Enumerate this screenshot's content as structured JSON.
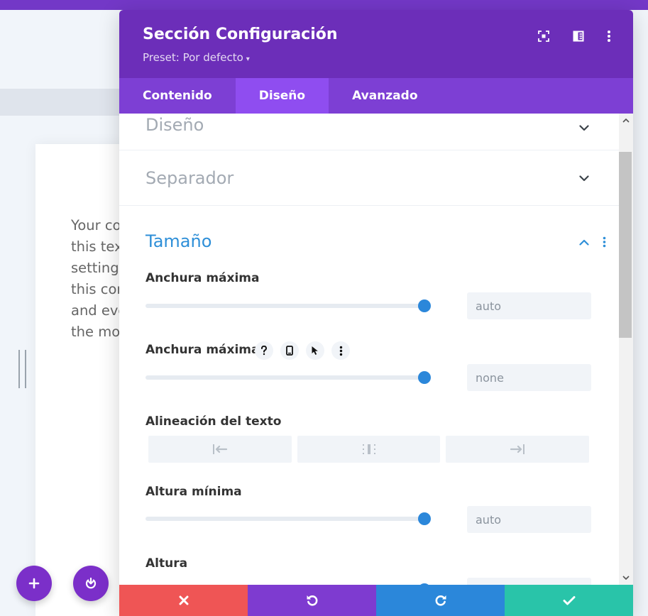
{
  "background": {
    "text_lines": [
      "Your co",
      "this tex",
      "settings",
      "this cor",
      "and eve",
      "the mod"
    ]
  },
  "modal": {
    "title": "Sección Configuración",
    "preset": "Preset: Por defecto",
    "header_icons": [
      "focus-mode-icon",
      "split-view-icon",
      "more-options-icon"
    ],
    "tabs": [
      {
        "label": "Contenido",
        "active": false
      },
      {
        "label": "Diseño",
        "active": true
      },
      {
        "label": "Avanzado",
        "active": false
      }
    ]
  },
  "panel": {
    "collapsed_sections": [
      {
        "title": "Diseño"
      },
      {
        "title": "Separador"
      }
    ],
    "open_section": {
      "title": "Tamaño",
      "fields": {
        "max_width": {
          "label": "Anchura máxima",
          "value": "auto"
        },
        "max_width_2": {
          "label": "Anchura máxima",
          "value": "none"
        },
        "text_align": {
          "label": "Alineación del texto",
          "options": [
            "align-left-icon",
            "align-center-icon",
            "align-right-icon"
          ]
        },
        "min_height": {
          "label": "Altura mínima",
          "value": "auto"
        },
        "height": {
          "label": "Altura"
        }
      }
    }
  },
  "footer": {
    "buttons": [
      "close-icon",
      "undo-icon",
      "redo-icon",
      "check-icon"
    ]
  },
  "colors": {
    "header": "#6c2eb9",
    "tabs": "#7d3fd4",
    "tab_active": "#8f4df0",
    "accent_blue": "#2b87da",
    "cancel": "#ef5555",
    "undo": "#7e3bd0",
    "redo": "#2b87da",
    "save": "#29c4a9"
  }
}
